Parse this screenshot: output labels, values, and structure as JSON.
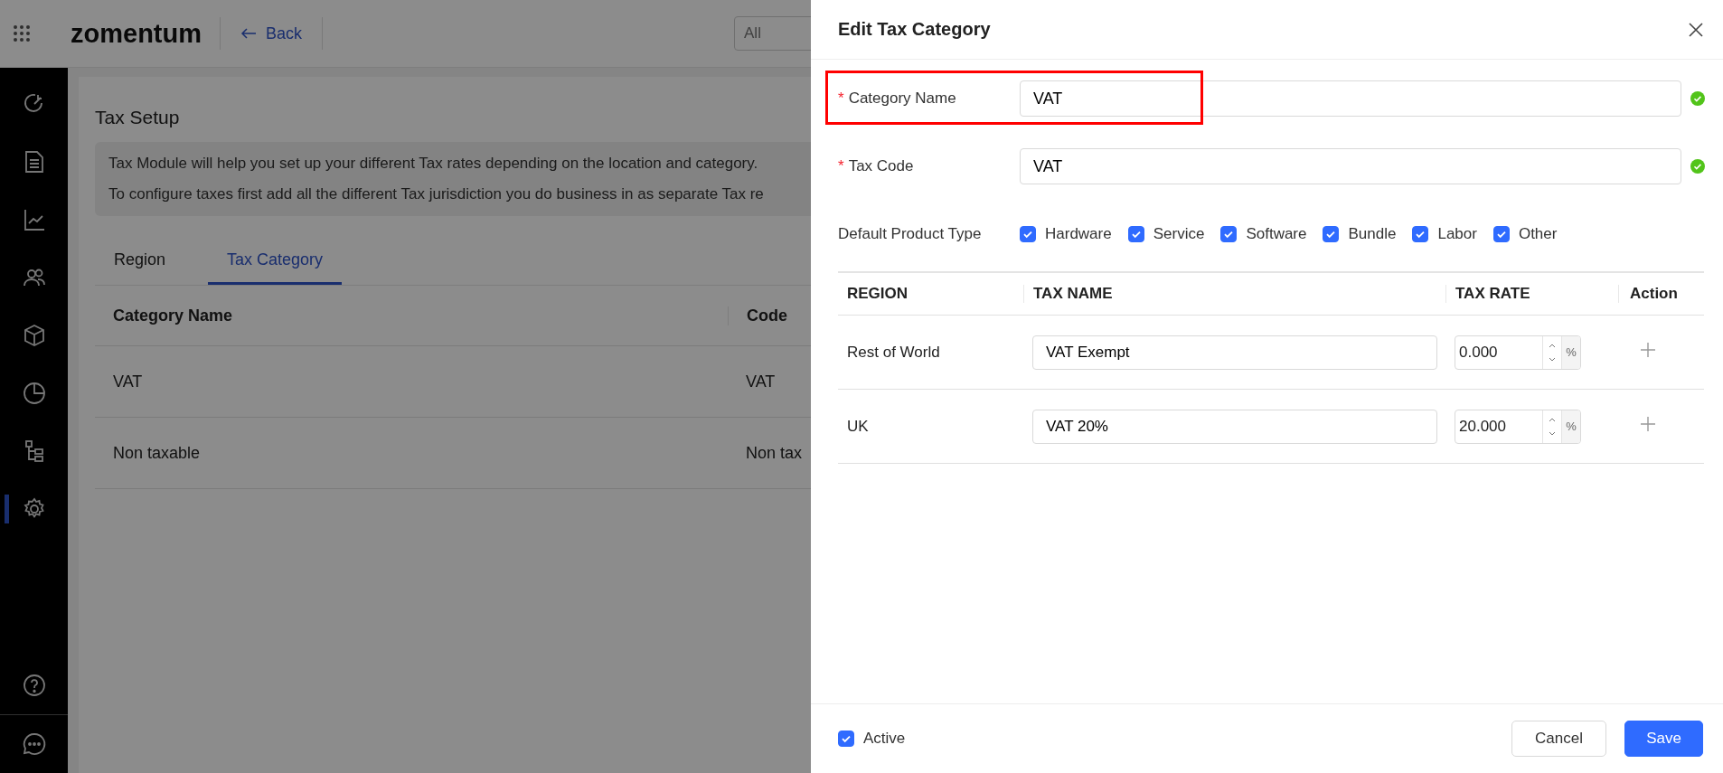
{
  "header": {
    "logo": "zomentum",
    "back": "Back",
    "search_placeholder": "All"
  },
  "sidebar": {
    "items": [
      {
        "kind": "goals",
        "selected": false
      },
      {
        "kind": "document",
        "selected": false
      },
      {
        "kind": "chart",
        "selected": false
      },
      {
        "kind": "people",
        "selected": false
      },
      {
        "kind": "box",
        "selected": false
      },
      {
        "kind": "pie",
        "selected": false
      },
      {
        "kind": "tree",
        "selected": false
      },
      {
        "kind": "settings",
        "selected": true
      }
    ],
    "bottom": [
      {
        "kind": "help"
      },
      {
        "kind": "chat"
      }
    ]
  },
  "page": {
    "title": "Tax Setup",
    "info": [
      "Tax Module will help you set up your different Tax rates depending on the location and category.",
      "To configure taxes first add all the different Tax jurisdiction you do business in as separate Tax re"
    ],
    "tabs": [
      {
        "label": "Region",
        "selected": false
      },
      {
        "label": "Tax Category",
        "selected": true
      }
    ],
    "table": {
      "columns": [
        "Category Name",
        "Code"
      ],
      "rows": [
        [
          "VAT",
          "VAT"
        ],
        [
          "Non taxable",
          "Non tax"
        ]
      ]
    }
  },
  "drawer": {
    "title": "Edit Tax Category",
    "fields": [
      {
        "required_mark": "*",
        "label": "Category Name",
        "value": "VAT",
        "valid": true,
        "highlighted": true
      },
      {
        "required_mark": "*",
        "label": "Tax Code",
        "value": "VAT",
        "valid": true
      }
    ],
    "product_type": {
      "label": "Default Product Type",
      "options": [
        {
          "label": "Hardware",
          "checked": true
        },
        {
          "label": "Service",
          "checked": true
        },
        {
          "label": "Software",
          "checked": true
        },
        {
          "label": "Bundle",
          "checked": true
        },
        {
          "label": "Labor",
          "checked": true
        },
        {
          "label": "Other",
          "checked": true
        }
      ]
    },
    "table": {
      "columns": [
        "REGION",
        "TAX NAME",
        "TAX RATE",
        "Action"
      ],
      "rows": [
        {
          "region": "Rest of World",
          "tax_name": "VAT Exempt",
          "rate": "0.000",
          "unit": "%"
        },
        {
          "region": "UK",
          "tax_name": "VAT 20%",
          "rate": "20.000",
          "unit": "%"
        }
      ]
    },
    "active": {
      "label": "Active",
      "checked": true
    },
    "buttons": {
      "cancel": "Cancel",
      "save": "Save"
    }
  }
}
